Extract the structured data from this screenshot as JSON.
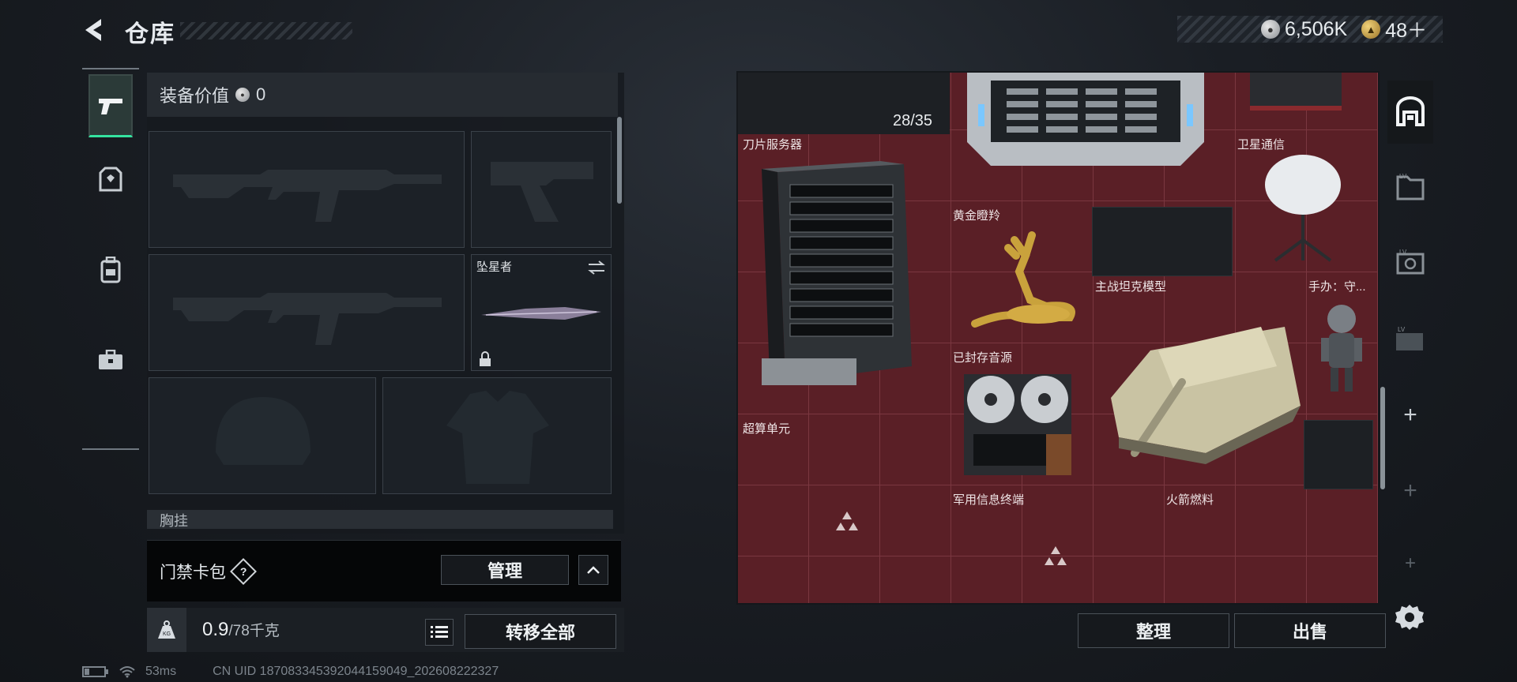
{
  "header": {
    "title": "仓库",
    "back_icon": "back-arrow-icon",
    "currency_silver": "6,506K",
    "currency_gold": "48＋"
  },
  "left_nav": {
    "items": [
      {
        "name": "weapon",
        "icon": "pistol-icon",
        "active": true
      },
      {
        "name": "armor",
        "icon": "armor-icon"
      },
      {
        "name": "backpack",
        "icon": "backpack-icon"
      },
      {
        "name": "toolbox",
        "icon": "toolbox-icon"
      }
    ]
  },
  "equipment": {
    "value_label": "装备价值",
    "value": "0",
    "melee_label": "坠星者",
    "partial_label": "胸挂",
    "keycard_label": "门禁卡包",
    "keycard_help": "?",
    "manage_label": "管理",
    "weight_value": "0.9",
    "weight_unit": "/78千克",
    "transfer_all_label": "转移全部"
  },
  "status": {
    "ping": "53ms",
    "uid": "CN UID 1870833453920441590​49_202608222327"
  },
  "warehouse": {
    "count": "28/35",
    "items": [
      {
        "label": "刀片服务器"
      },
      {
        "label": "卫星通信"
      },
      {
        "label": "黄金瞪羚"
      },
      {
        "label": "主战坦克模型"
      },
      {
        "label": "手办：守..."
      },
      {
        "label": "已封存音源"
      },
      {
        "label": "超算单元"
      },
      {
        "label": "军用信息终端"
      },
      {
        "label": "火箭燃料"
      }
    ],
    "sort_label": "整理",
    "sell_label": "出售"
  },
  "right_bar": {
    "plus": "+",
    "settings_icon": "gear-icon"
  },
  "colors": {
    "grid_bg": "#5a1f26",
    "active_accent": "#34e3a0"
  }
}
